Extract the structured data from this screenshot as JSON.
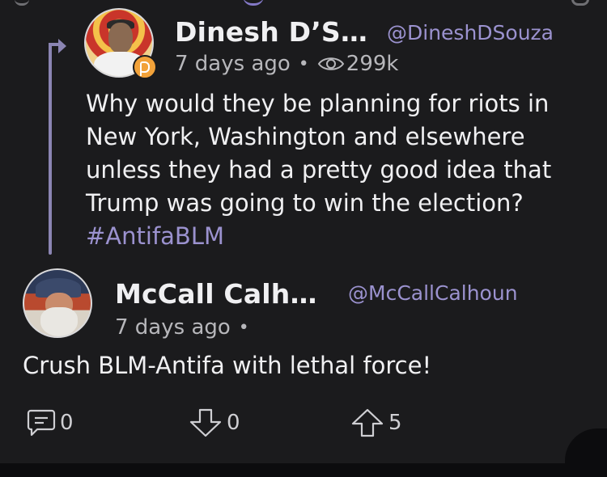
{
  "parent_post": {
    "author_name": "Dinesh D’S…",
    "handle": "@DineshDSouza",
    "time": "7 days ago",
    "separator": "•",
    "views": "299k",
    "text_main": "Why would they be planning for riots in New York, Washington and elsewhere unless they had a pretty good idea that Trump was going to win the election? ",
    "hashtag": "#AntifaBLM"
  },
  "reply_post": {
    "author_name": "McCall Calh…",
    "handle": "@McCallCalhoun",
    "time": "7 days ago",
    "separator": "•",
    "text": "Crush BLM-Antifa with lethal force!"
  },
  "actions": {
    "comments": "0",
    "downvotes": "0",
    "upvotes": "5"
  },
  "colors": {
    "background": "#1b1b1d",
    "accent": "#9b92cf",
    "thread_line": "#8b85b3",
    "badge": "#f2a23a"
  }
}
